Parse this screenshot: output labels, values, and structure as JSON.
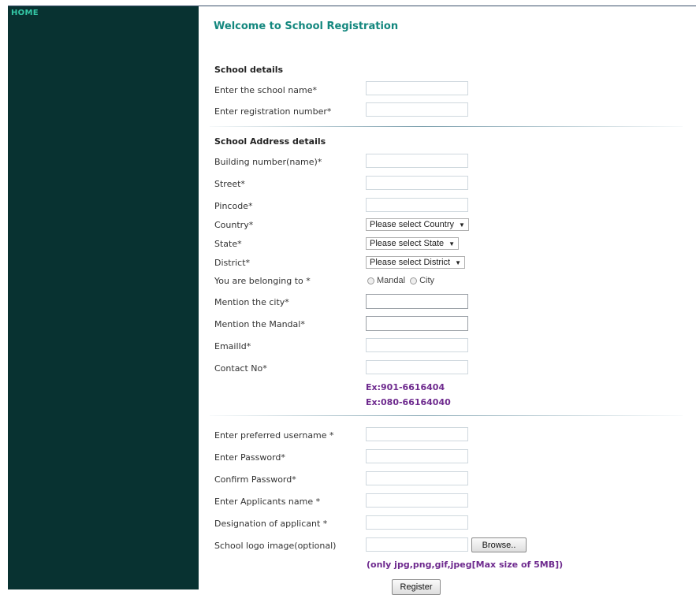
{
  "sidebar": {
    "home_label": "HOME"
  },
  "page": {
    "title": "Welcome to School Registration"
  },
  "sections": {
    "school_details": "School details",
    "address_details": "School Address details"
  },
  "fields": {
    "school_name": "Enter the school name*",
    "registration_number": "Enter registration number*",
    "building_number": "Building number(name)*",
    "street": "Street*",
    "pincode": "Pincode*",
    "country": "Country*",
    "state": "State*",
    "district": "District*",
    "belonging_to": "You are belonging to *",
    "mention_city": "Mention the city*",
    "mention_mandal": "Mention the Mandal*",
    "email": "EmailId*",
    "contact": "Contact No*",
    "username": "Enter preferred username *",
    "password": "Enter Password*",
    "confirm_password": "Confirm Password*",
    "applicant_name": "Enter Applicants name *",
    "designation": "Designation of applicant *",
    "logo": "School logo image(optional)"
  },
  "selects": {
    "country": "Please select Country",
    "state": "Please select State",
    "district": "Please select District"
  },
  "radios": {
    "mandal": "Mandal",
    "city": "City"
  },
  "hints": {
    "contact_ex1": "Ex:901-6616404",
    "contact_ex2": "Ex:080-66164040",
    "logo_formats": "(only jpg,png,gif,jpeg[Max size of 5MB])"
  },
  "buttons": {
    "browse": "Browse..",
    "register": "Register"
  },
  "icons": {
    "dropdown": "chevron-down-icon",
    "radio": "radio-icon"
  },
  "colors": {
    "sidebar_bg": "#083231",
    "title": "#13877e",
    "hint": "#6e2a8e",
    "home": "#34c8a6"
  }
}
